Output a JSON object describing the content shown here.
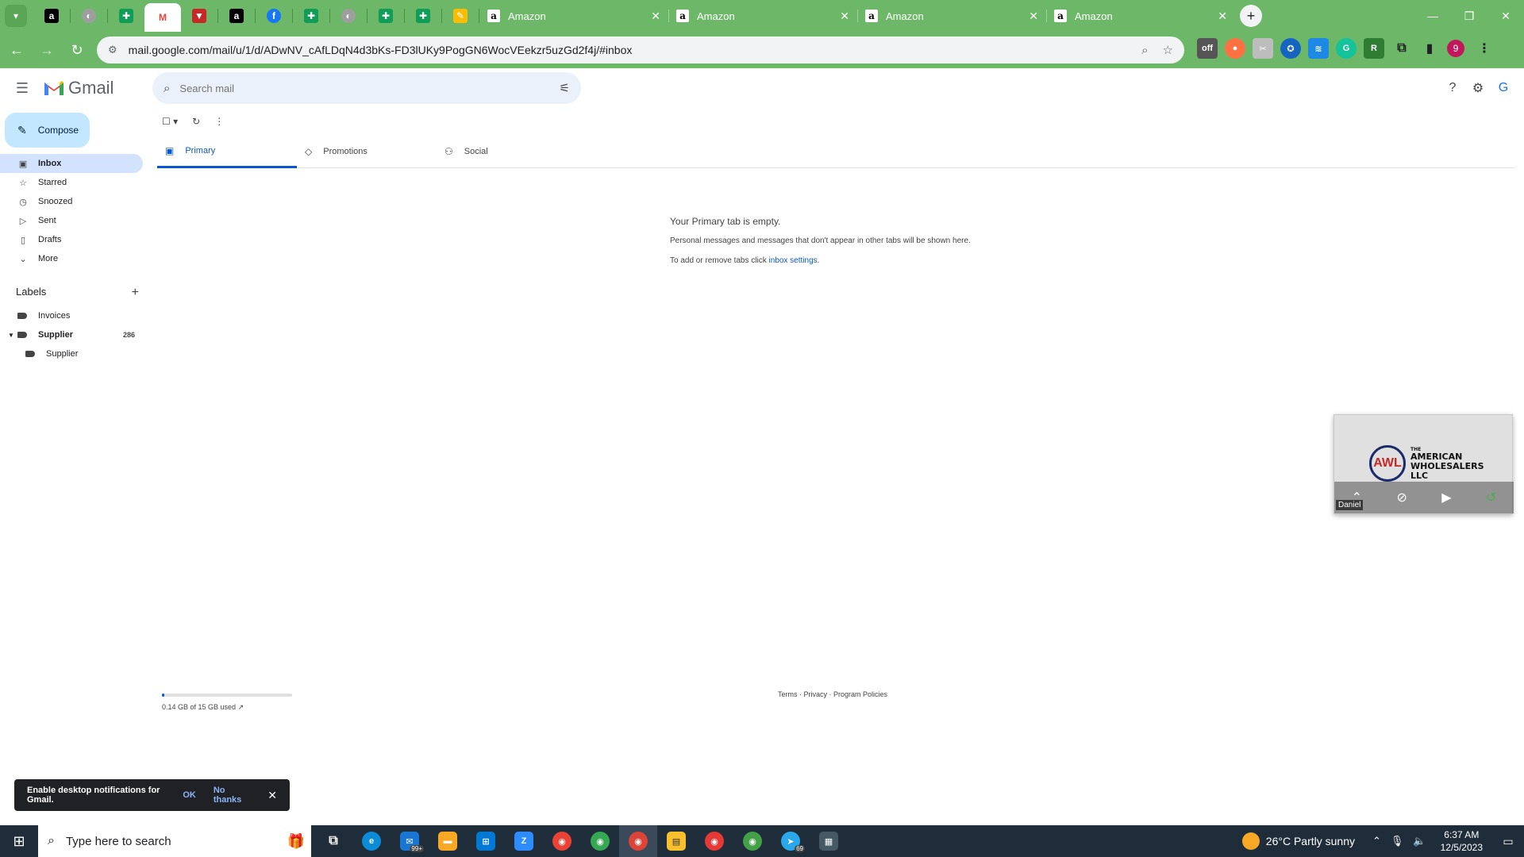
{
  "browser": {
    "tabs": [
      {
        "title": "Amazon",
        "favicon": "a"
      },
      {
        "title": "Amazon",
        "favicon": "a"
      },
      {
        "title": "Amazon",
        "favicon": "a"
      },
      {
        "title": "Amazon",
        "favicon": "a"
      }
    ],
    "url": "mail.google.com/mail/u/1/d/ADwNV_cAfLDqN4d3bKs-FD3lUKy9PogGN6WocVEekzr5uzGd2f4j/#inbox",
    "profile_initial": "9",
    "accent_color": "#6db868"
  },
  "gmail": {
    "logo_text": "Gmail",
    "search_placeholder": "Search mail",
    "compose_label": "Compose",
    "nav": [
      {
        "label": "Inbox",
        "icon": "inbox-icon",
        "active": true
      },
      {
        "label": "Starred",
        "icon": "star-icon"
      },
      {
        "label": "Snoozed",
        "icon": "clock-icon"
      },
      {
        "label": "Sent",
        "icon": "send-icon"
      },
      {
        "label": "Drafts",
        "icon": "draft-icon"
      },
      {
        "label": "More",
        "icon": "chevron-down-icon"
      }
    ],
    "labels_heading": "Labels",
    "labels": [
      {
        "name": "Invoices"
      },
      {
        "name": "Supplier",
        "count": "286"
      },
      {
        "name": "Supplier"
      }
    ],
    "tabs": [
      {
        "label": "Primary",
        "icon": "inbox-icon"
      },
      {
        "label": "Promotions",
        "icon": "tag-icon"
      },
      {
        "label": "Social",
        "icon": "people-icon"
      }
    ],
    "empty": {
      "heading": "Your Primary tab is empty.",
      "line1": "Personal messages and messages that don't appear in other tabs will be shown here.",
      "line2_prefix": "To add or remove tabs click ",
      "line2_link": "inbox settings",
      "line2_suffix": "."
    },
    "storage": {
      "text": "0.14 GB of 15 GB used",
      "fraction": 0.0093
    },
    "footer": "Terms · Privacy · Program Policies",
    "snackbar": {
      "message": "Enable desktop notifications for Gmail.",
      "ok": "OK",
      "no": "No thanks"
    }
  },
  "pip": {
    "brand_line1": "THE",
    "brand_line2": "AMERICAN",
    "brand_line3": "WHOLESALERS",
    "brand_line4": "LLC",
    "logo_letters": "AWL",
    "caller": "Daniel"
  },
  "taskbar": {
    "search_placeholder": "Type here to search",
    "weather": "26°C  Partly sunny",
    "time": "6:37 AM",
    "date": "12/5/2023",
    "mail_badge": "99+",
    "telegram_badge": "69"
  }
}
